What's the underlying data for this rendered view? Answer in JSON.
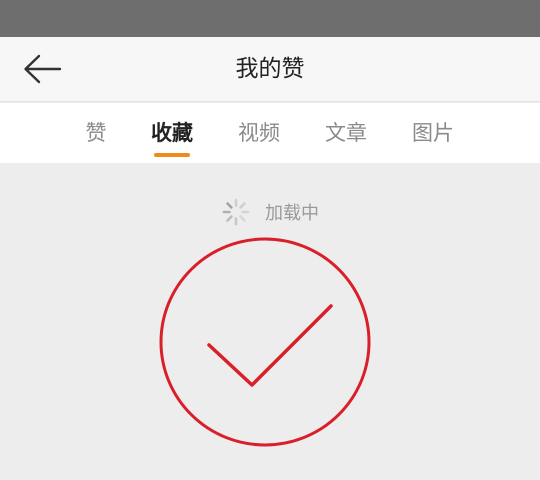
{
  "header": {
    "title": "我的赞",
    "back_icon": "arrow-left-icon"
  },
  "tabs": [
    {
      "label": "赞",
      "active": false
    },
    {
      "label": "收藏",
      "active": true
    },
    {
      "label": "视频",
      "active": false
    },
    {
      "label": "文章",
      "active": false
    },
    {
      "label": "图片",
      "active": false
    }
  ],
  "loading": {
    "text": "加载中",
    "icon": "loading-spinner-icon"
  },
  "annotation": {
    "icon": "check-circle-icon",
    "color": "#d9202a"
  },
  "colors": {
    "accent": "#f08a1c",
    "background": "#ededed",
    "status_bar": "#6e6e6e"
  }
}
